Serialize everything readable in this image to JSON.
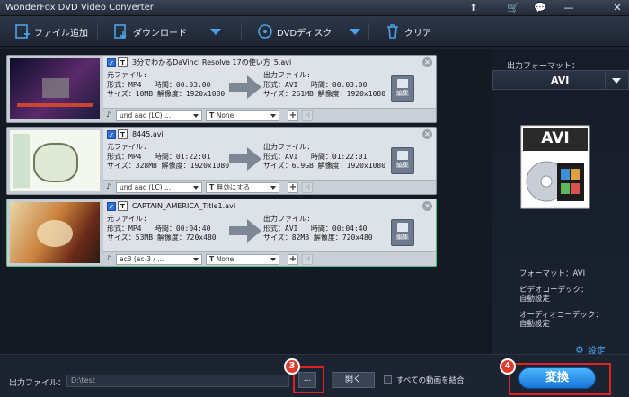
{
  "app": {
    "title": "WonderFox DVD Video Converter"
  },
  "titlebar_buttons": [
    "⬆",
    "🛒",
    "💬",
    "—",
    "✕"
  ],
  "toolbar": {
    "add_file": "ファイル追加",
    "download": "ダウンロード",
    "dvd_disc": "DVDディスク",
    "clear": "クリア"
  },
  "labels": {
    "source": "元ファイル:",
    "output": "出力ファイル:",
    "edit": "編集"
  },
  "files": [
    {
      "name": "3分でわかるDaVinci Resolve 17の使い方_5.avi",
      "src": {
        "format": "形式：MP4",
        "time": "時間：00:03:00",
        "size": "サイズ：10MB",
        "res": "解像度：1920x1080"
      },
      "out": {
        "format": "形式：AVI",
        "time": "時間：00:03:00",
        "size": "サイズ：261MB",
        "res": "解像度：1920x1080"
      },
      "audio": "und aac (LC) ...",
      "subtitle": "None",
      "selected": false
    },
    {
      "name": "8445.avi",
      "src": {
        "format": "形式：MP4",
        "time": "時間：01:22:01",
        "size": "サイズ：328MB",
        "res": "解像度：1920x1080"
      },
      "out": {
        "format": "形式：AVI",
        "time": "時間：01:22:01",
        "size": "サイズ：6.9GB",
        "res": "解像度：1920x1080"
      },
      "audio": "und aac (LC) ...",
      "subtitle": "無効にする",
      "selected": false
    },
    {
      "name": "CAPTAIN_AMERICA_Title1.avi",
      "src": {
        "format": "形式：MP4",
        "time": "時間：00:04:40",
        "size": "サイズ：53MB",
        "res": "解像度：720x480"
      },
      "out": {
        "format": "形式：AVI",
        "time": "時間：00:04:40",
        "size": "サイズ：82MB",
        "res": "解像度：720x480"
      },
      "audio": "ac3 (ac-3 / ...",
      "subtitle": "None",
      "selected": true
    }
  ],
  "right_panel": {
    "output_format_label": "出力フォーマット：",
    "format_value": "AVI",
    "icon_text": "AVI",
    "format_info": "フォーマット：AVI",
    "video_codec_label": "ビデオコーデック：",
    "video_codec_value": "自動設定",
    "audio_codec_label": "オーディオコーデック：",
    "audio_codec_value": "自動設定",
    "settings": "設定"
  },
  "bottom": {
    "output_label": "出力ファイル：",
    "output_path": "D:\\test",
    "browse": "...",
    "open": "開く",
    "merge_label": "すべての動画を結合",
    "convert": "変換"
  },
  "callouts": {
    "browse_step": "3",
    "convert_step": "4"
  },
  "colors": {
    "accent": "#1e88e5",
    "callout_red": "#e02222",
    "selected_border": "#52c07a"
  }
}
